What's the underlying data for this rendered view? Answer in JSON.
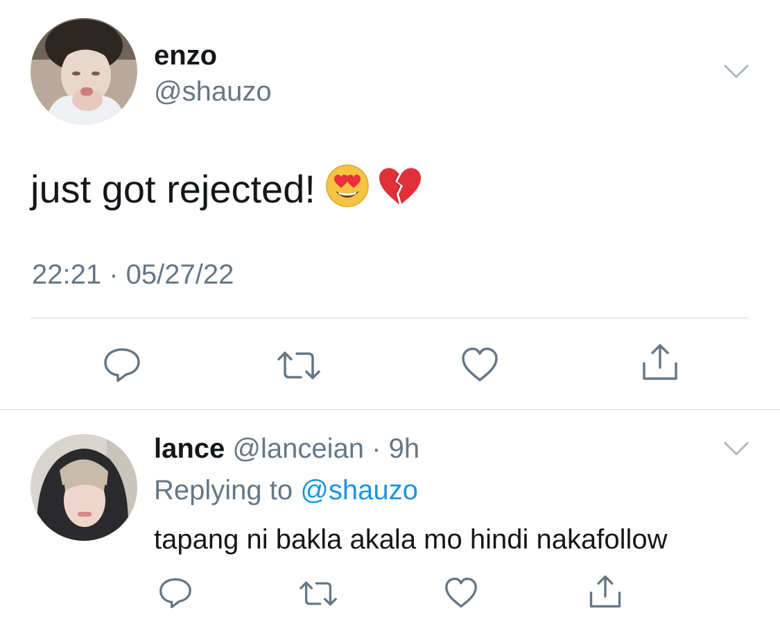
{
  "tweet": {
    "display_name": "enzo",
    "handle": "@shauzo",
    "text": "just got rejected!",
    "emojis": [
      "smiling-face-with-heart-eyes",
      "broken-heart"
    ],
    "timestamp": "22:21 · 05/27/22",
    "actions": [
      "reply-icon",
      "retweet-icon",
      "like-icon",
      "share-icon"
    ]
  },
  "reply": {
    "display_name": "lance",
    "handle": "@lanceian",
    "separator": "·",
    "time_ago": "9h",
    "replying_to_label": "Replying to",
    "replying_to_handle": "@shauzo",
    "text": "tapang ni bakla akala mo hindi nakafollow",
    "actions": [
      "reply-icon",
      "retweet-icon",
      "like-icon",
      "share-icon"
    ]
  },
  "colors": {
    "text_primary": "#14171a",
    "text_secondary": "#657786",
    "link": "#1b95e0",
    "divider": "#d3d8dc",
    "icon": "#657786"
  }
}
